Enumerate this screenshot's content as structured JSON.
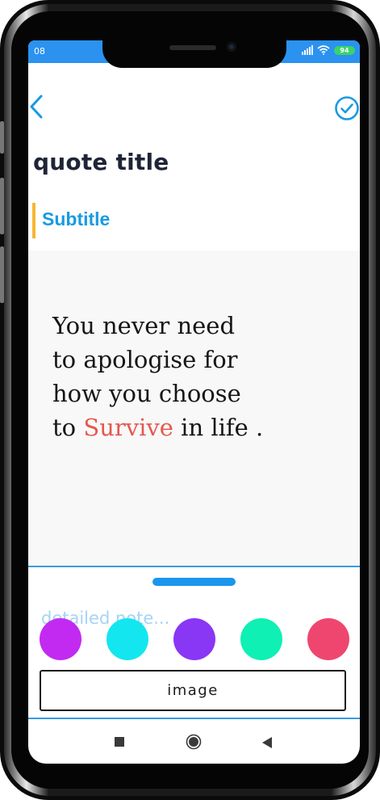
{
  "status_bar": {
    "time": "08",
    "battery": "94",
    "bar_color": "#2b92f0"
  },
  "header": {
    "back_icon": "chevron-left-icon",
    "confirm_icon": "check-circle-icon",
    "accent_color": "#1a9ae0"
  },
  "quote_title": "quote title",
  "subtitle": "Subtitle",
  "quote": {
    "lines": [
      "You never need",
      "to apologise for",
      "how you choose"
    ],
    "last_line_before": "to ",
    "highlight": "Survive",
    "last_line_after": " in life .",
    "highlight_color": "#e5584f"
  },
  "note": {
    "placeholder": "detailed note..."
  },
  "color_swatches": [
    "#c22af2",
    "#14e6f0",
    "#8a36f5",
    "#0ff0b4",
    "#ef4670"
  ],
  "image_button": {
    "label": "image"
  },
  "nav_bar": {
    "recents_icon": "square-icon",
    "home_icon": "circle-icon",
    "back_icon": "triangle-back-icon"
  }
}
